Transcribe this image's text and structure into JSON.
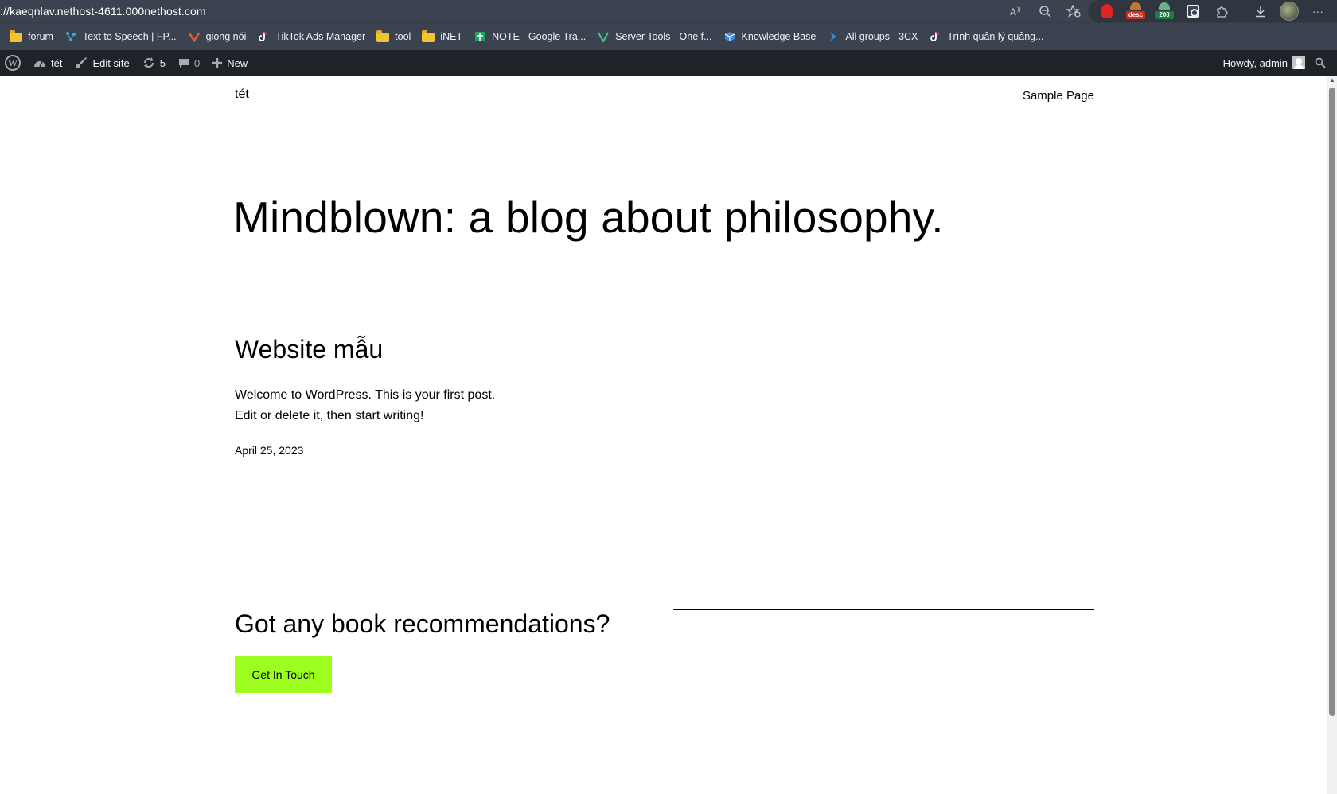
{
  "browser": {
    "url": "://kaeqnlav.nethost-4611.000nethost.com",
    "extensions": {
      "desc_badge": "desc",
      "status_badge": "200"
    },
    "toolbar_icons": [
      "read-aloud-icon",
      "zoom-out-icon",
      "favorite-icon",
      "extension-icon",
      "download-icon",
      "profile-avatar",
      "more-icon"
    ],
    "more_label": "···"
  },
  "bookmarks": [
    {
      "label": "forum",
      "icon": "folder-icon"
    },
    {
      "label": "Text to Speech | FP...",
      "icon": "tts-icon"
    },
    {
      "label": "giọng nói",
      "icon": "voice-icon"
    },
    {
      "label": "TikTok Ads Manager",
      "icon": "tiktok-icon"
    },
    {
      "label": "tool",
      "icon": "folder-icon"
    },
    {
      "label": "iNET",
      "icon": "folder-icon"
    },
    {
      "label": "NOTE - Google Tra...",
      "icon": "sheets-icon"
    },
    {
      "label": "Server Tools - One f...",
      "icon": "server-icon"
    },
    {
      "label": "Knowledge Base",
      "icon": "knowledge-icon"
    },
    {
      "label": "All groups - 3CX",
      "icon": "3cx-icon"
    },
    {
      "label": "Trình quản lý quảng...",
      "icon": "tiktok-icon"
    }
  ],
  "admin_bar": {
    "site_name": "tét",
    "edit_site": "Edit site",
    "updates_count": "5",
    "comments_count": "0",
    "new_label": "New",
    "howdy": "Howdy, admin"
  },
  "site": {
    "title": "tét",
    "nav": [
      "Sample Page"
    ]
  },
  "hero": {
    "title": "Mindblown: a blog about philosophy."
  },
  "post": {
    "title": "Website mẫu",
    "excerpt_line1": "Welcome to WordPress. This is your first post.",
    "excerpt_line2": "Edit or delete it, then start writing!",
    "date": "April 25, 2023"
  },
  "cta": {
    "heading": "Got any book recommendations?",
    "button": "Get In Touch",
    "button_color": "#9dff20"
  }
}
